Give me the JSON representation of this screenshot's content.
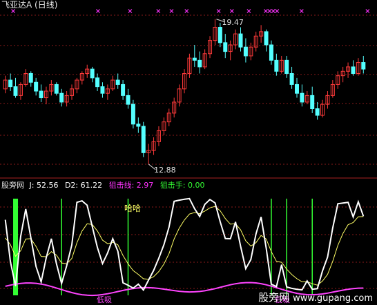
{
  "header": {
    "title": "飞亚达A (日线)"
  },
  "price_panel": {
    "high_label": "19.47",
    "low_label": "12.88",
    "up_color": "#ff3a3a",
    "down_color": "#54ffff",
    "candles": [
      [
        16.3,
        16.9,
        16.1,
        16.7
      ],
      [
        16.7,
        17.0,
        16.2,
        16.4
      ],
      [
        16.4,
        16.8,
        15.9,
        16.0
      ],
      [
        16.0,
        16.6,
        15.8,
        16.5
      ],
      [
        16.5,
        17.2,
        16.4,
        17.0
      ],
      [
        17.0,
        17.1,
        16.4,
        16.6
      ],
      [
        16.6,
        16.8,
        16.0,
        16.2
      ],
      [
        16.2,
        16.5,
        15.7,
        15.9
      ],
      [
        15.9,
        16.4,
        15.6,
        16.2
      ],
      [
        16.2,
        16.7,
        16.0,
        16.5
      ],
      [
        16.5,
        16.6,
        16.0,
        16.1
      ],
      [
        16.1,
        16.3,
        15.5,
        15.7
      ],
      [
        15.7,
        16.2,
        15.5,
        16.0
      ],
      [
        16.0,
        16.5,
        15.8,
        16.3
      ],
      [
        16.3,
        16.8,
        16.1,
        16.7
      ],
      [
        16.7,
        17.1,
        16.5,
        17.0
      ],
      [
        17.0,
        17.4,
        16.8,
        17.2
      ],
      [
        17.2,
        17.3,
        16.6,
        16.8
      ],
      [
        16.8,
        17.0,
        16.2,
        16.4
      ],
      [
        16.4,
        16.6,
        15.9,
        16.1
      ],
      [
        16.1,
        16.5,
        15.8,
        16.3
      ],
      [
        16.3,
        16.9,
        16.2,
        16.7
      ],
      [
        16.7,
        17.0,
        16.3,
        16.5
      ],
      [
        16.5,
        16.7,
        15.8,
        16.0
      ],
      [
        16.0,
        16.3,
        15.4,
        15.6
      ],
      [
        15.6,
        15.8,
        14.5,
        14.7
      ],
      [
        14.7,
        15.0,
        14.3,
        14.6
      ],
      [
        14.6,
        14.8,
        13.2,
        13.4
      ],
      [
        13.4,
        13.8,
        12.88,
        13.5
      ],
      [
        13.5,
        14.1,
        13.3,
        13.9
      ],
      [
        13.9,
        14.6,
        13.7,
        14.4
      ],
      [
        14.4,
        15.0,
        14.2,
        14.8
      ],
      [
        14.8,
        15.4,
        14.6,
        15.2
      ],
      [
        15.2,
        15.9,
        15.0,
        15.7
      ],
      [
        15.7,
        16.5,
        15.5,
        16.3
      ],
      [
        16.3,
        17.2,
        16.1,
        17.0
      ],
      [
        17.0,
        17.9,
        16.8,
        17.7
      ],
      [
        17.7,
        18.3,
        17.3,
        17.6
      ],
      [
        17.6,
        18.0,
        17.0,
        17.3
      ],
      [
        17.3,
        18.1,
        17.2,
        17.9
      ],
      [
        17.9,
        18.7,
        17.7,
        18.5
      ],
      [
        18.5,
        19.47,
        18.3,
        19.1
      ],
      [
        19.1,
        19.3,
        18.2,
        18.4
      ],
      [
        18.4,
        18.8,
        17.7,
        18.0
      ],
      [
        18.0,
        18.5,
        17.6,
        18.3
      ],
      [
        18.3,
        19.0,
        18.1,
        18.8
      ],
      [
        18.8,
        19.1,
        18.0,
        18.2
      ],
      [
        18.2,
        18.6,
        17.5,
        17.8
      ],
      [
        17.8,
        18.4,
        17.6,
        18.2
      ],
      [
        18.2,
        18.9,
        18.0,
        18.7
      ],
      [
        18.7,
        19.2,
        18.4,
        18.9
      ],
      [
        18.9,
        19.0,
        18.0,
        18.3
      ],
      [
        18.3,
        18.5,
        17.4,
        17.6
      ],
      [
        17.6,
        17.9,
        16.9,
        17.1
      ],
      [
        17.1,
        17.8,
        17.0,
        17.6
      ],
      [
        17.6,
        17.8,
        16.8,
        17.0
      ],
      [
        17.0,
        17.3,
        16.3,
        16.5
      ],
      [
        16.5,
        16.8,
        15.9,
        16.1
      ],
      [
        16.1,
        16.5,
        15.5,
        15.7
      ],
      [
        15.7,
        16.2,
        15.6,
        16.0
      ],
      [
        16.0,
        16.4,
        15.2,
        15.4
      ],
      [
        15.4,
        15.7,
        14.9,
        15.1
      ],
      [
        15.1,
        15.8,
        15.0,
        15.6
      ],
      [
        15.6,
        16.2,
        15.4,
        16.0
      ],
      [
        16.0,
        16.7,
        15.9,
        16.5
      ],
      [
        16.5,
        17.1,
        16.3,
        16.9
      ],
      [
        16.9,
        17.3,
        16.6,
        17.1
      ],
      [
        17.1,
        17.5,
        16.8,
        17.3
      ],
      [
        17.3,
        17.6,
        16.9,
        17.0
      ],
      [
        17.0,
        17.7,
        16.9,
        17.5
      ],
      [
        17.5,
        17.8,
        17.0,
        17.2
      ]
    ],
    "markers_x_fraction": [
      0.035,
      0.26,
      0.345,
      0.42,
      0.455,
      0.495,
      0.58,
      0.615,
      0.66,
      0.705,
      0.715,
      0.725,
      0.735,
      0.8,
      0.975
    ]
  },
  "indicator_panel": {
    "name": "股旁网",
    "j_label": "J: 52.56",
    "d2_label": "D2: 61.22",
    "sniper_line_label": "狙击线: 2.97",
    "sniper_hand_label": "狙击手: 0.00",
    "annotation_haha": "哈哈",
    "low_label_1": "低吸",
    "low_label_2": "低吸",
    "colors": {
      "j": "#ffffff",
      "d2": "#ffff66",
      "sniper_line": "#ff44ff",
      "sniper_hand": "#33ff33"
    }
  },
  "watermark": {
    "brand": "股旁网",
    "url": "www.gupang.com"
  }
}
